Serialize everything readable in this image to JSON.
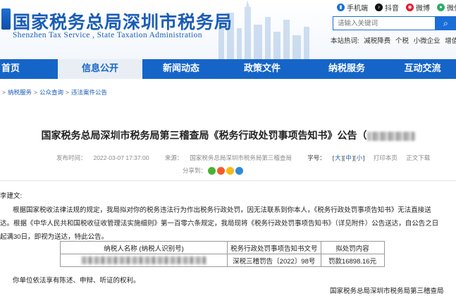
{
  "header": {
    "title": "国家税务总局深圳市税务局",
    "subtitle": "Shenzhen Tax Service , State Taxation Administration",
    "top_links": [
      {
        "icon": "mobile-icon",
        "label": "手机端"
      },
      {
        "icon": "tiktok-icon",
        "label": "抖音"
      },
      {
        "icon": "weibo-icon",
        "label": "微博"
      },
      {
        "icon": "wechat-icon",
        "label": "微信"
      }
    ],
    "search_placeholder": "请输入关键词",
    "hot_words_label": "本站热词:",
    "hot_words": [
      "减税降费",
      "个税",
      "小微企业",
      "增值税"
    ]
  },
  "nav": {
    "items": [
      "首页",
      "信息公开",
      "新闻动态",
      "政策文件",
      "纳税服务",
      "互动交流"
    ],
    "active_index": 1
  },
  "breadcrumb": [
    "纳税服务",
    "公众查询",
    "违法案件公告"
  ],
  "article": {
    "title": "国家税务总局深圳市税务局第三稽查局《税务行政处罚事项告知书》公告（",
    "title_end": "）",
    "published_label": "发布时间：",
    "published": "2022-03-07 17:37:00",
    "source_label": "来源：",
    "source": "国家税务总局深圳市税务局第三稽查局",
    "font_label": "字号：",
    "font_sizes": [
      "大",
      "中",
      "小"
    ],
    "print_label": "打印本页",
    "close_label": "正文下载",
    "share_label": "分享到：",
    "salutation": "李建文:",
    "para1": "根据国家税收法律法规的规定，我局拟对你的税务违法行为作出税务行政处罚，因无法联系到你本人，《税务行政处罚事项告知书》无法直接送",
    "para2": "达。根据《中华人民共和国税收征收管理法实施细则》第一百零六条规定，我局现将《税务行政处罚事项告知书》（详见附件）公告送达，自公告之日",
    "para3": "起满30日，即视为送达，特此公告。",
    "table": {
      "headers": [
        "纳税人名称 (纳税人识别号)",
        "税务行政处罚事项告知书文号",
        "拟处罚内容"
      ],
      "row": {
        "doc_no": "深税三稽罚告〔2022〕98号",
        "penalty": "罚款16898.16元"
      }
    },
    "rights": "你单位依法享有陈述、申辩、听证的权利。",
    "signature": "国家税务总局深圳市税务局第三稽查局"
  }
}
